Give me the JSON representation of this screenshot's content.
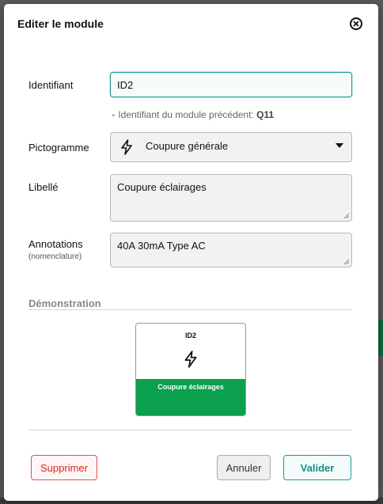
{
  "dialog": {
    "title": "Editer le module",
    "close_icon": "close-circle-icon"
  },
  "form": {
    "identifier": {
      "label": "Identifiant",
      "value": "ID2",
      "hint_prefix": "Identifiant du module précédent:",
      "hint_value": "Q11"
    },
    "pictogram": {
      "label": "Pictogramme",
      "icon": "lightning-icon",
      "selected": "Coupure générale"
    },
    "caption": {
      "label": "Libellé",
      "value": "Coupure éclairages"
    },
    "annotations": {
      "label": "Annotations",
      "sublabel": "(nomenclature)",
      "value": "40A 30mA Type AC"
    }
  },
  "demo": {
    "section_title": "Démonstration",
    "module_id": "ID2",
    "icon": "lightning-icon",
    "module_label": "Coupure éclairages",
    "color": "#0aa04d"
  },
  "actions": {
    "delete": "Supprimer",
    "cancel": "Annuler",
    "validate": "Valider"
  },
  "colors": {
    "accent": "#1e9a93",
    "danger": "#d9261c"
  }
}
